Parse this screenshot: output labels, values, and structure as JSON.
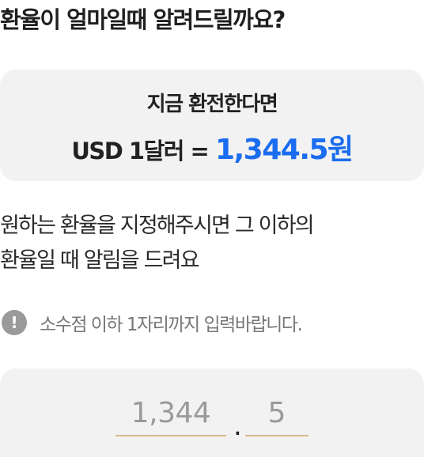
{
  "title": "환율이 얼마일때 알려드릴까요?",
  "rate_card": {
    "heading": "지금 환전한다면",
    "prefix": "USD 1달러 = ",
    "value": "1,344.5원",
    "value_color": "#1a6df0"
  },
  "description": {
    "line1": "원하는 환율을 지정해주시면 그 이하의",
    "line2": "환율일 때 알림을 드려요"
  },
  "notice": {
    "icon": "exclamation-icon",
    "icon_glyph": "!",
    "text": "소수점 이하 1자리까지 입력바랍니다."
  },
  "rate_input": {
    "integer_placeholder": "1,344",
    "separator": ".",
    "decimal_placeholder": "5",
    "underline_color": "#d6b98a"
  }
}
